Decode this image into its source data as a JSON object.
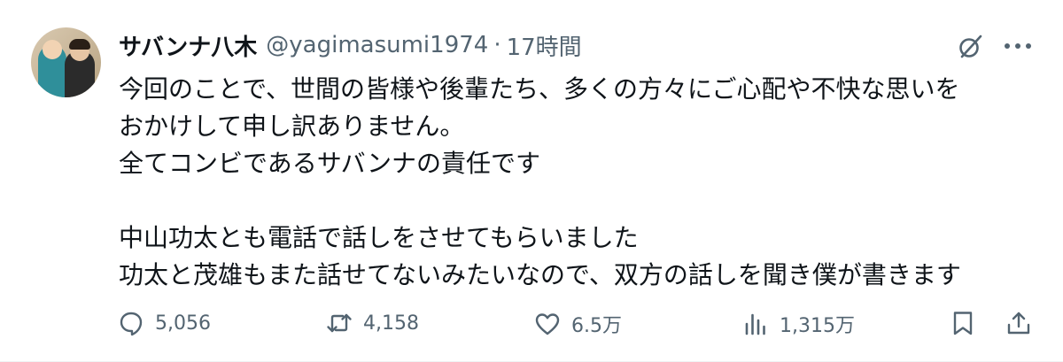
{
  "tweet": {
    "display_name": "サバンナ八木",
    "handle": "@yagimasumi1974",
    "separator": "·",
    "time": "17時間",
    "text_lines": [
      "今回のことで、世間の皆様や後輩たち、多くの方々にご心配や不快な思いを",
      "おかけして申し訳ありません。",
      "全てコンビであるサバンナの責任です",
      "",
      "中山功太とも電話で話しをさせてもらいました",
      "功太と茂雄もまた話せてないみたいなので、双方の話しを聞き僕が書きます"
    ]
  },
  "actions": {
    "replies": "5,056",
    "retweets": "4,158",
    "likes": "6.5万",
    "views": "1,315万"
  },
  "icons": {
    "grok": "grok-icon",
    "more": "more-options-icon",
    "reply": "reply-icon",
    "retweet": "retweet-icon",
    "like": "heart-icon",
    "views": "views-icon",
    "bookmark": "bookmark-icon",
    "share": "share-icon"
  },
  "colors": {
    "text_primary": "#0f1419",
    "text_secondary": "#536471",
    "background": "#ffffff"
  }
}
